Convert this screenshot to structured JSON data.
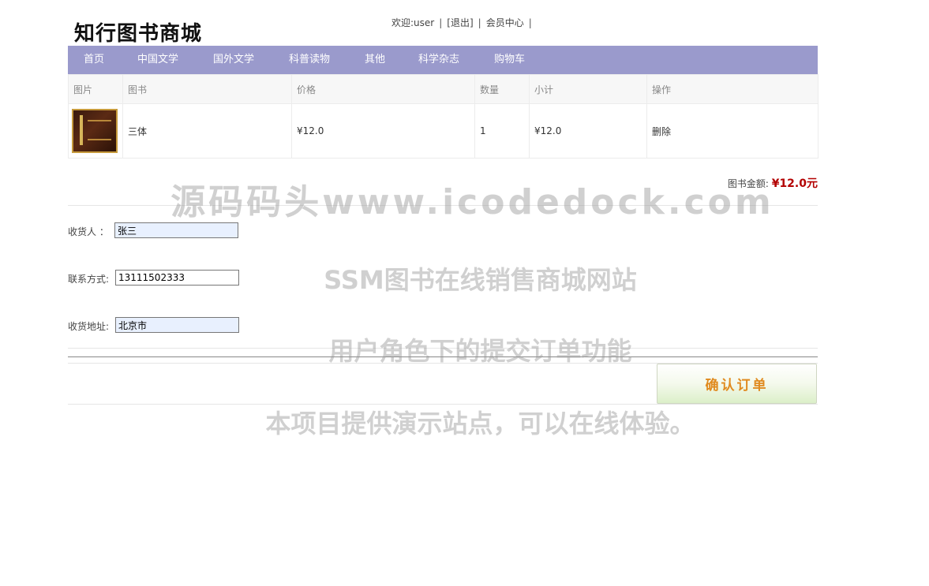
{
  "header": {
    "logo": "知行图书商城",
    "welcome": "欢迎:user",
    "logout": "[退出]",
    "member_center": "会员中心",
    "sep": "|"
  },
  "nav": {
    "items": [
      "首页",
      "中国文学",
      "国外文学",
      "科普读物",
      "其他",
      "科学杂志",
      "购物车"
    ]
  },
  "cart": {
    "headers": [
      "图片",
      "图书",
      "价格",
      "数量",
      "小计",
      "操作"
    ],
    "rows": [
      {
        "title": "三体",
        "price": "¥12.0",
        "qty": "1",
        "subtotal": "¥12.0",
        "action": "删除"
      }
    ]
  },
  "summary": {
    "label": "图书金额:",
    "amount": "¥12.0元"
  },
  "form": {
    "receiver_label": "收货人 ：",
    "receiver_value": "张三",
    "phone_label": "联系方式:",
    "phone_value": "13111502333",
    "address_label": "收货地址:",
    "address_value": "北京市"
  },
  "confirm_label": "确认订单",
  "watermark": {
    "line1": "源码码头www.icodedock.com",
    "line2": "SSM图书在线销售商城网站",
    "line3": "用户角色下的提交订单功能",
    "line4": "本项目提供演示站点，可以在线体验。"
  },
  "colors": {
    "nav_bg": "#9a9acc",
    "price_red": "#b30000",
    "confirm_text": "#e08a1e"
  }
}
